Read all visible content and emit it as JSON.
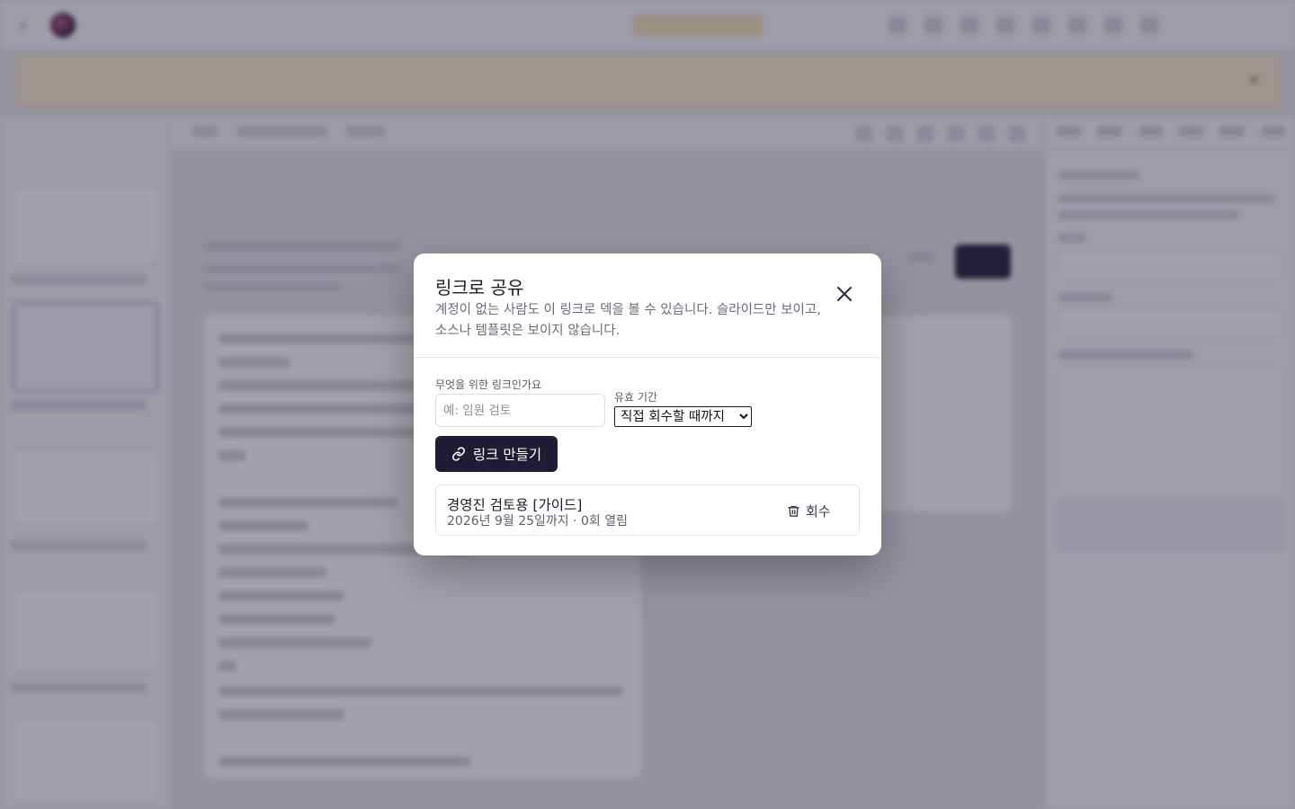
{
  "modal": {
    "title": "링크로 공유",
    "description": "계정이 없는 사람도 이 링크로 덱을 볼 수 있습니다. 슬라이드만 보이고, 소스나 템플릿은 보이지 않습니다.",
    "close_icon": "close-icon",
    "form": {
      "purpose_label": "무엇을 위한 링크인가요",
      "purpose_placeholder": "예: 임원 검토",
      "purpose_value": "",
      "expiry_label": "유효 기간",
      "expiry_selected": "직접 회수할 때까지"
    },
    "create_button": {
      "label": "링크 만들기",
      "icon": "link-icon"
    },
    "links": [
      {
        "name": "경영진 검토용 [가이드]",
        "meta": "2026년 9월 25일까지 · 0회 열림",
        "revoke_label": "회수",
        "revoke_icon": "trash-icon"
      }
    ]
  },
  "colors": {
    "primary_button": "#1f1d36",
    "overlay": "rgba(34,30,52,0.42)",
    "modal_bg": "#ffffff",
    "muted_text": "#6b6a78"
  }
}
